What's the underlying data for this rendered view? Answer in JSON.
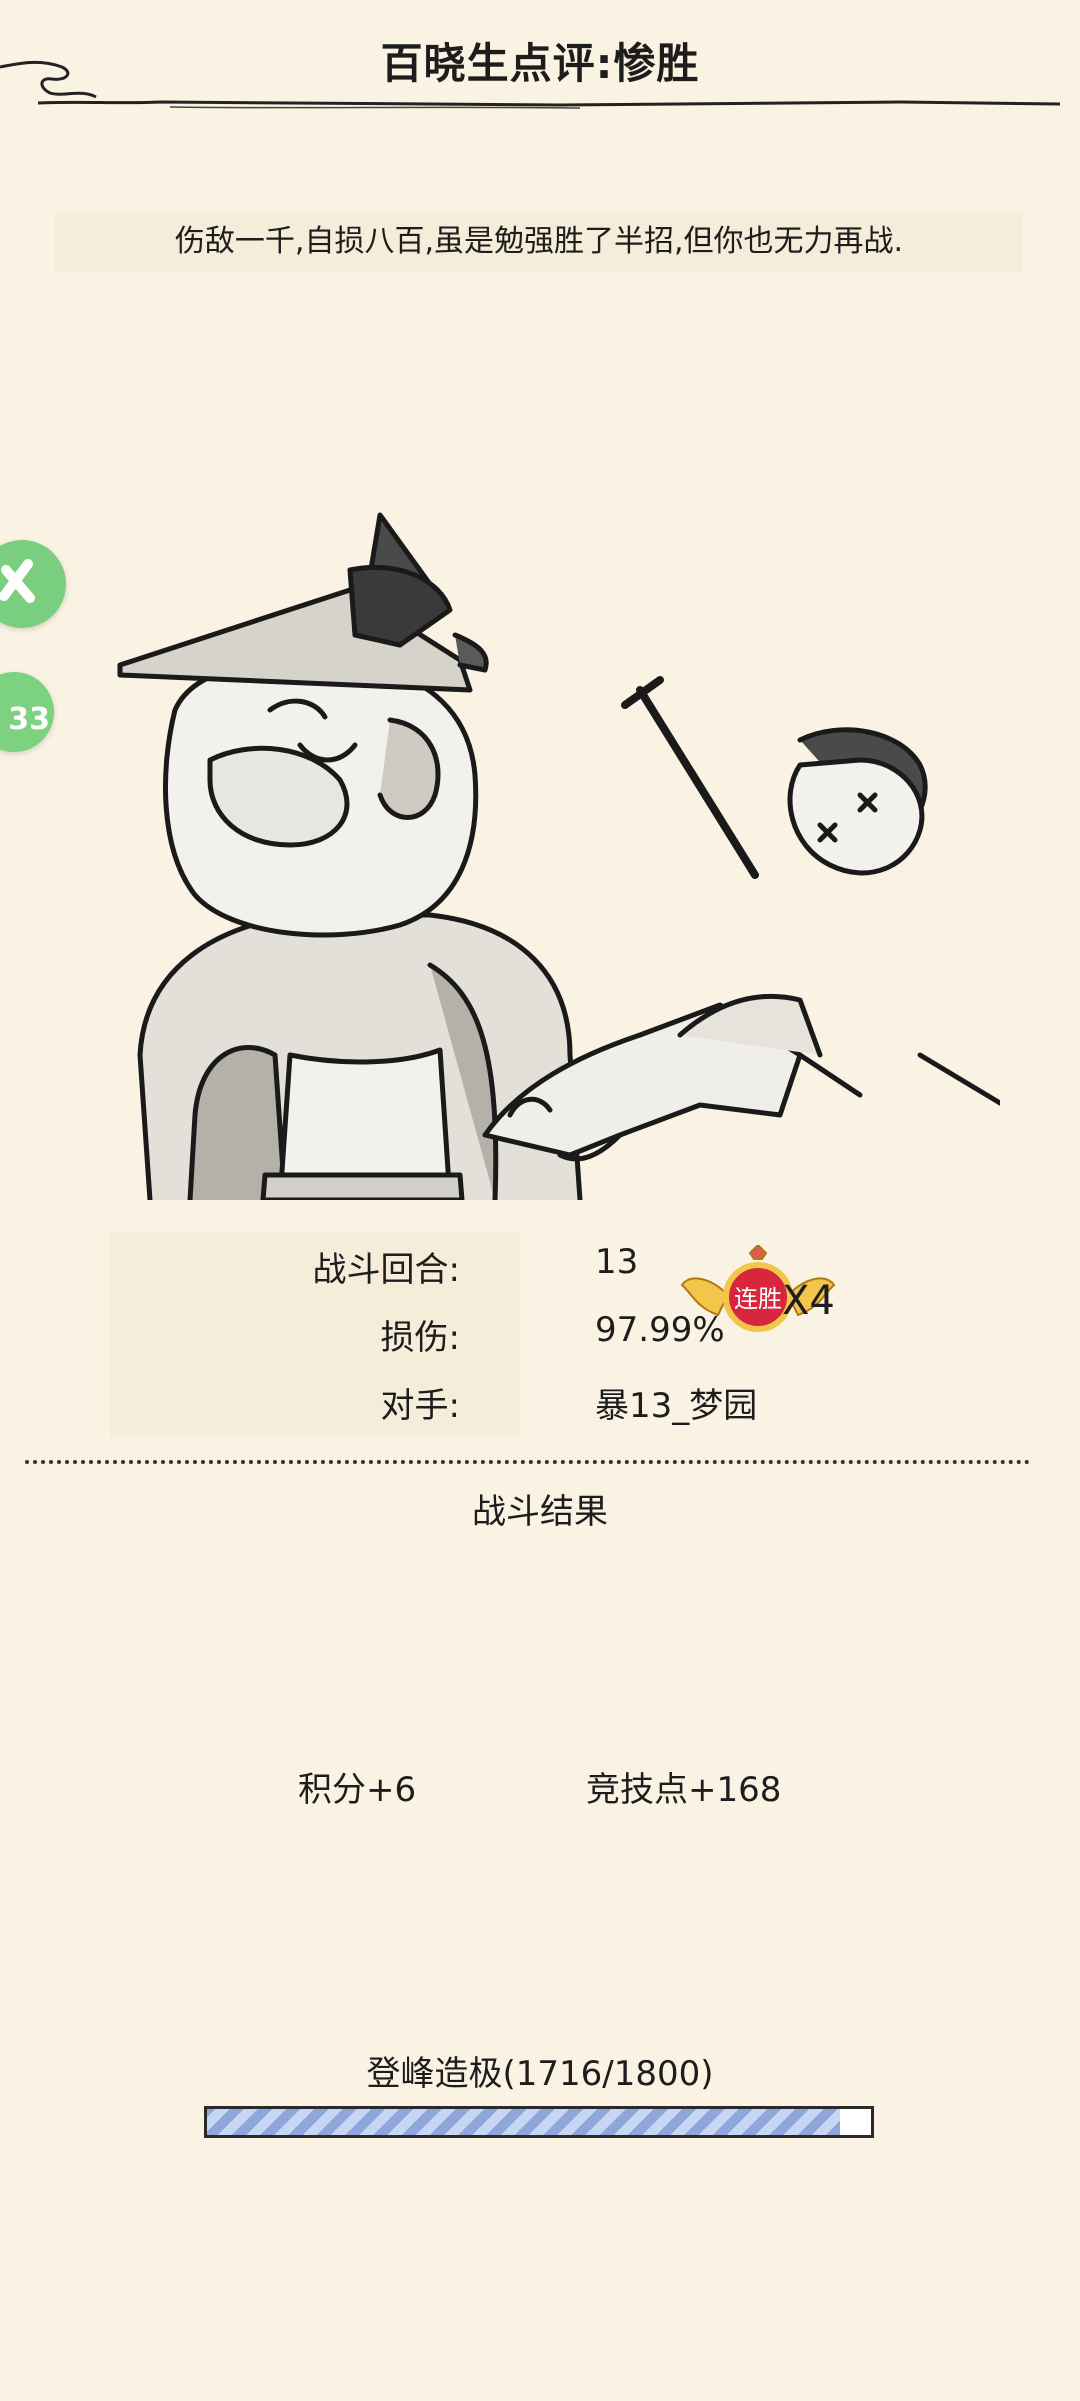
{
  "header": {
    "title": "百晓生点评:惨胜"
  },
  "comment": "伤敌一千,自损八百,虽是勉强胜了半招,但你也无力再战.",
  "floating": {
    "badge_count": "33"
  },
  "stats": {
    "rounds_label": "战斗回合:",
    "rounds_value": "13",
    "damage_label": "损伤:",
    "damage_value": "97.99%",
    "opponent_label": "对手:",
    "opponent_value": "暴13_梦园"
  },
  "streak": {
    "badge_text": "连胜",
    "count": "X4"
  },
  "result": {
    "title": "战斗结果",
    "points": "积分+6",
    "arena_points": "竞技点+168"
  },
  "rank": {
    "title": "登峰造极(1716/1800)",
    "progress": 0.953
  }
}
